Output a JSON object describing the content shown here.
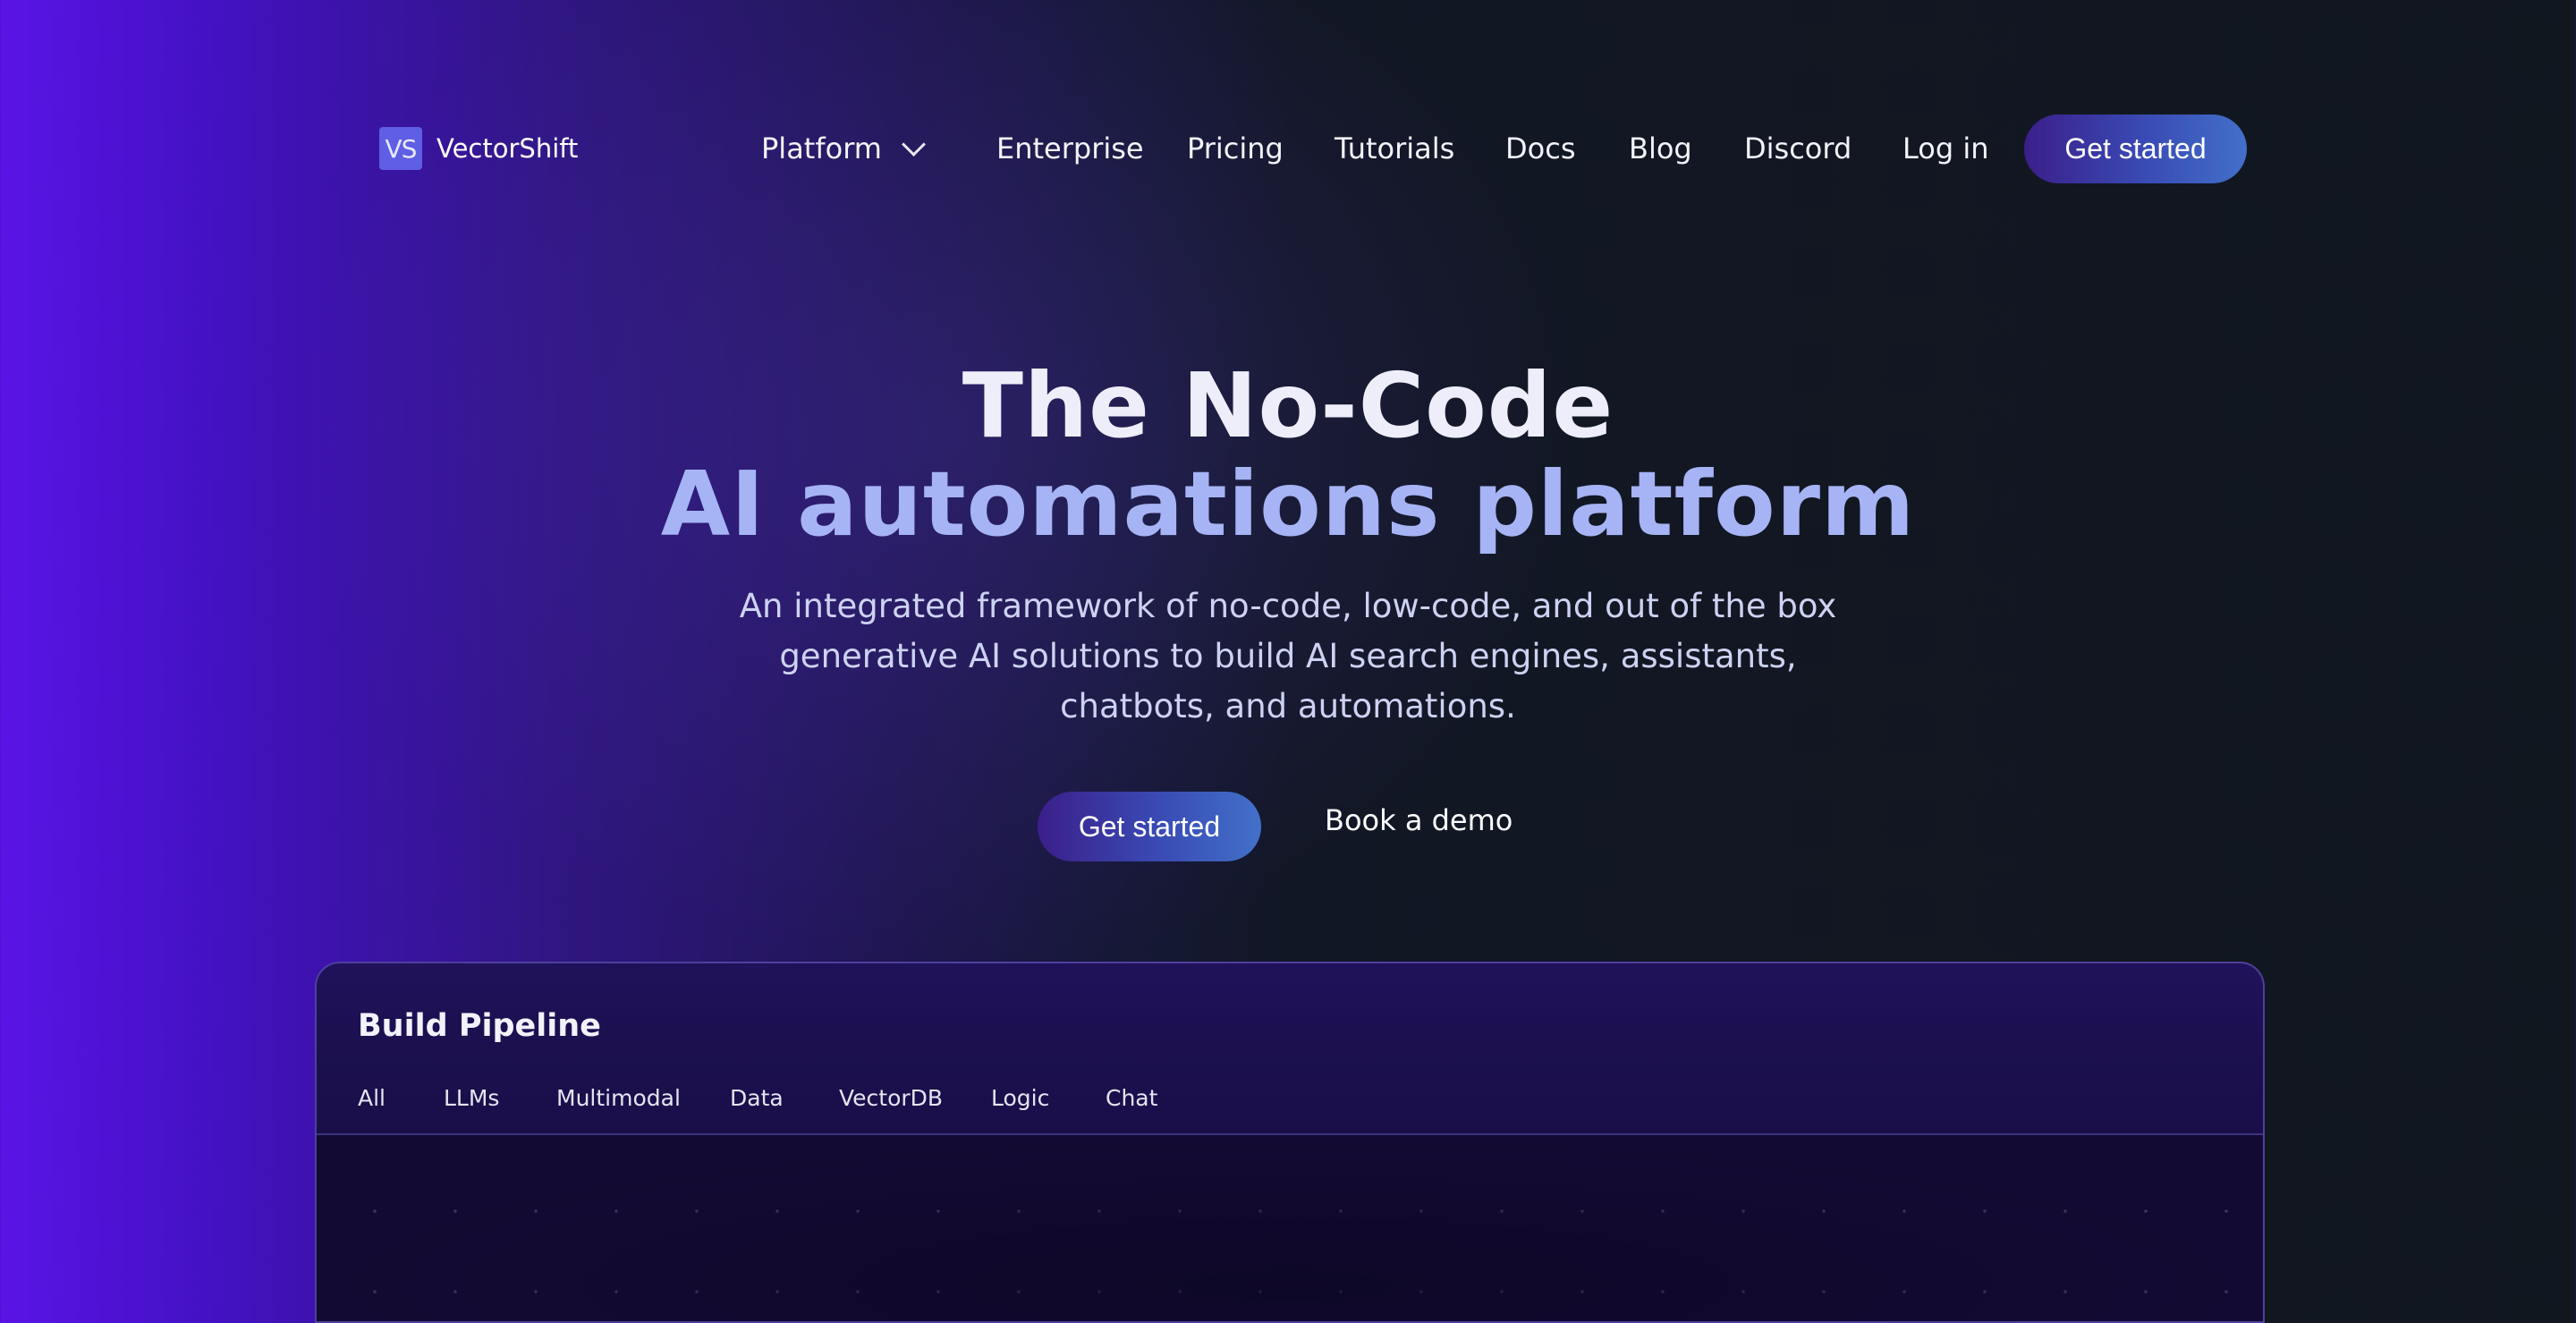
{
  "brand": {
    "logo_mark": "VS",
    "name": "VectorShift",
    "accent": "#5f5ee4"
  },
  "nav": {
    "platform": "Platform",
    "enterprise": "Enterprise",
    "pricing": "Pricing",
    "tutorials": "Tutorials",
    "docs": "Docs",
    "blog": "Blog",
    "discord": "Discord",
    "login": "Log in",
    "cta": "Get started"
  },
  "hero": {
    "title_line1": "The No-Code",
    "title_line2": "AI automations platform",
    "subtitle_line1": "An integrated framework of no-code, low-code, and out of the box",
    "subtitle_line2": "generative AI solutions to build AI search engines, assistants,",
    "subtitle_line3": "chatbots, and automations.",
    "primary_button": "Get started",
    "secondary_button": "Book a demo"
  },
  "pipeline": {
    "title": "Build Pipeline",
    "tabs": [
      "All",
      "LLMs",
      "Multimodal",
      "Data",
      "VectorDB",
      "Logic",
      "Chat"
    ]
  }
}
